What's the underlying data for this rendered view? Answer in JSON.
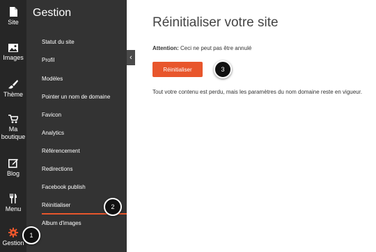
{
  "rail": {
    "items": [
      {
        "label": "Site",
        "icon": "file-icon"
      },
      {
        "label": "Images",
        "icon": "image-icon"
      },
      {
        "label": "Thème",
        "icon": "brush-icon"
      },
      {
        "label": "Ma\nboutique",
        "label_line1": "Ma",
        "label_line2": "boutique",
        "icon": "cart-icon"
      },
      {
        "label": "Blog",
        "icon": "edit-icon"
      },
      {
        "label": "Menu",
        "icon": "fork-knife-icon"
      },
      {
        "label": "Gestion",
        "icon": "gear-icon"
      }
    ],
    "active_color": "#e8562c"
  },
  "panel": {
    "title": "Gestion",
    "items": [
      "Statut du site",
      "Profil",
      "Modèles",
      "Pointer un nom de domaine",
      "Favicon",
      "Analytics",
      "Référencement",
      "Redirections",
      "Facebook publish",
      "Réinitialiser",
      "Album d'images"
    ],
    "collapse_glyph": "‹"
  },
  "main": {
    "title": "Réinitialiser votre site",
    "attention_label": "Attention:",
    "attention_text": "Ceci ne peut pas être annulé",
    "button_label": "Réinitialiser",
    "info_text": "Tout votre contenu est perdu, mais les paramètres du nom domaine reste en vigueur."
  },
  "callouts": [
    "1",
    "2",
    "3"
  ],
  "colors": {
    "accent": "#e8562c",
    "rail_bg": "#262626",
    "panel_bg": "#333333"
  }
}
